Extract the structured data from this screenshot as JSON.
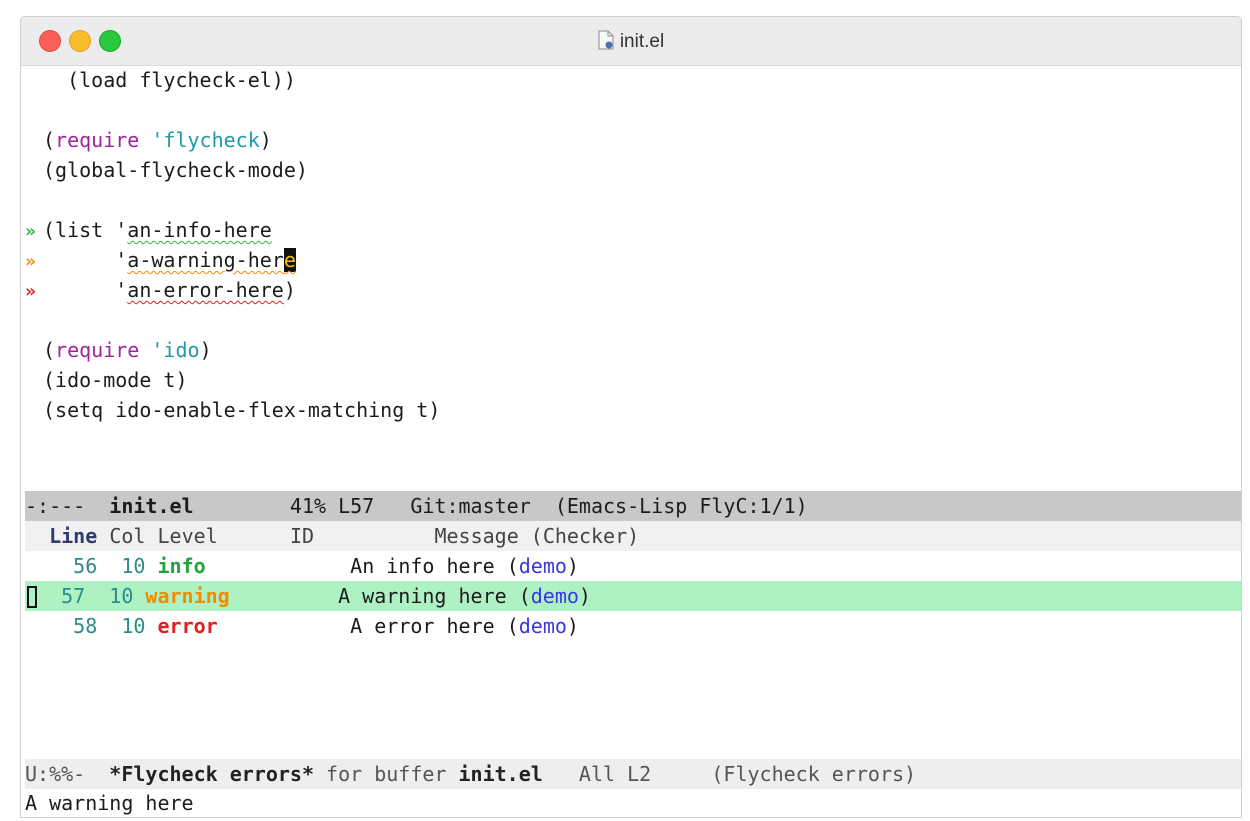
{
  "window": {
    "title": "init.el"
  },
  "code": {
    "line1": {
      "text": "  (load flycheck-el))"
    },
    "line3": {
      "open": "(",
      "kw": "require",
      "sym": " 'flycheck",
      "close": ")"
    },
    "line4": {
      "text": "(global-flycheck-mode)"
    },
    "line6": {
      "marker": "»",
      "pre": "(list '",
      "flag": "an-info-here"
    },
    "line7": {
      "marker": "»",
      "pre": "      '",
      "flag": "a-warning-her",
      "cursor_char": "e"
    },
    "line8": {
      "marker": "»",
      "pre": "      '",
      "flag": "an-error-here",
      "post": ")"
    },
    "line10": {
      "open": "(",
      "kw": "require",
      "sym": " 'ido",
      "close": ")"
    },
    "line11": {
      "text": "(ido-mode t)"
    },
    "line12": {
      "text": "(setq ido-enable-flex-matching t)"
    }
  },
  "modeline_top": {
    "status": "-:---  ",
    "buffer": "init.el",
    "position": "        41% L57   ",
    "vc": "Git:master  ",
    "modes": "(Emacs-Lisp FlyC:1/1)"
  },
  "errors": {
    "columns": {
      "line": "Line",
      "col": "Col",
      "level": "Level",
      "id": "ID",
      "message": "Message (Checker)"
    },
    "rows": [
      {
        "line": "56",
        "col": "10",
        "level": "info",
        "message": "An info here (",
        "checker": "demo",
        "close": ")"
      },
      {
        "line": "57",
        "col": "10",
        "level": "warning",
        "message": "A warning here (",
        "checker": "demo",
        "close": ")"
      },
      {
        "line": "58",
        "col": "10",
        "level": "error",
        "message": "A error here (",
        "checker": "demo",
        "close": ")"
      }
    ]
  },
  "modeline_bottom": {
    "status": "U:%%-  ",
    "buffer": "*Flycheck errors*",
    "for_text": " for buffer ",
    "target": "init.el",
    "position": "   All L2     ",
    "modes": "(Flycheck errors)"
  },
  "echo_area": {
    "text": "A warning here"
  },
  "colors": {
    "info": "#2db33a",
    "warning": "#f28b00",
    "error": "#e02020",
    "selection": "#aef2c4",
    "checker": "#3a35e8"
  }
}
